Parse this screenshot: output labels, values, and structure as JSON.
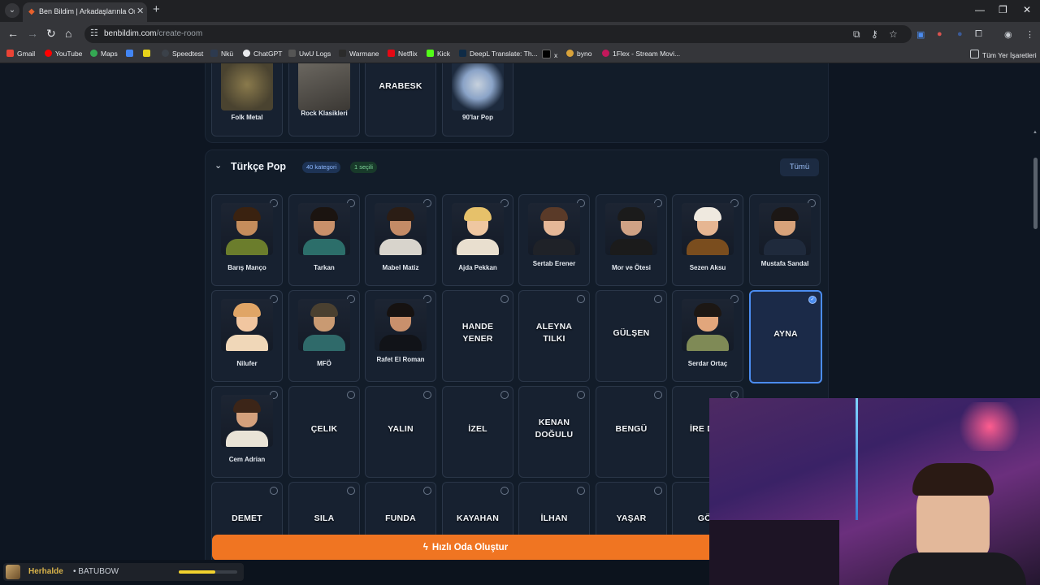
{
  "browser": {
    "tab_title": "Ben Bildim | Arkadaşlarınla Onli...",
    "url_domain": "benbildim.com",
    "url_path": "/create-room",
    "bookmarks": [
      "Gmail",
      "YouTube",
      "Maps",
      "",
      "",
      "Speedtest",
      "Nkü",
      "ChatGPT",
      "UwU Logs",
      "Warmane",
      "Netflix",
      "Kick",
      "DeepL Translate: Th...",
      "x",
      "byno",
      "1Flex - Stream Movi..."
    ],
    "all_bookmarks": "Tüm Yer İşaretleri"
  },
  "colors": {
    "accent": "#4b8cf0",
    "cta": "#f07522",
    "panel": "#121c29"
  },
  "top_section": {
    "cards": [
      {
        "label": "Folk Metal",
        "type": "image"
      },
      {
        "label": "Rock Klasikleri",
        "type": "image"
      },
      {
        "label": "ARABESK",
        "type": "text"
      },
      {
        "label": "90'lar Pop",
        "type": "image"
      }
    ]
  },
  "section": {
    "title": "Türkçe Pop",
    "count_badge": "40 kategori",
    "selected_badge": "1 seçili",
    "all_button": "Tümü",
    "rows": [
      [
        {
          "label": "Barış Manço",
          "type": "avatar",
          "skin": "#c58d5c",
          "hair": "#3a2210",
          "body": "#6b7d2c"
        },
        {
          "label": "Tarkan",
          "type": "avatar",
          "skin": "#c8906a",
          "hair": "#1b1410",
          "body": "#2c6e6a"
        },
        {
          "label": "Mabel Matiz",
          "type": "avatar",
          "skin": "#c48b66",
          "hair": "#2b1d15",
          "body": "#d8d4cc"
        },
        {
          "label": "Ajda Pekkan",
          "type": "avatar",
          "skin": "#efc7a1",
          "hair": "#e6c16a",
          "body": "#e9dfcf"
        },
        {
          "label": "Sertab Erener",
          "type": "avatar",
          "skin": "#e5b797",
          "hair": "#5a3a28",
          "body": "#1f2228"
        },
        {
          "label": "Mor ve Ötesi",
          "type": "avatar",
          "skin": "#cfa285",
          "hair": "#1b1b1b",
          "body": "#1b1b1b"
        },
        {
          "label": "Sezen Aksu",
          "type": "avatar",
          "skin": "#e6b692",
          "hair": "#efe9df",
          "body": "#7a4d1e"
        },
        {
          "label": "Mustafa Sandal",
          "type": "avatar",
          "skin": "#d7a27a",
          "hair": "#1c1715",
          "body": "#1f2a3c"
        }
      ],
      [
        {
          "label": "Nilufer",
          "type": "avatar",
          "skin": "#f1c6a0",
          "hair": "#e0a566",
          "body": "#f0d7b8"
        },
        {
          "label": "MFÖ",
          "type": "avatar",
          "skin": "#c99a72",
          "hair": "#4a4030",
          "body": "#2f6a6a"
        },
        {
          "label": "Rafet El Roman",
          "type": "avatar",
          "skin": "#c9906c",
          "hair": "#161211",
          "body": "#111318"
        },
        {
          "label": "HANDE YENER",
          "type": "text"
        },
        {
          "label": "ALEYNA TILKI",
          "type": "text"
        },
        {
          "label": "GÜLŞEN",
          "type": "text"
        },
        {
          "label": "Serdar Ortaç",
          "type": "avatar",
          "skin": "#e2a67c",
          "hair": "#1c1714",
          "body": "#7f8a56"
        },
        {
          "label": "AYNA",
          "type": "text",
          "selected": true
        }
      ],
      [
        {
          "label": "Cem Adrian",
          "type": "avatar",
          "skin": "#d4a07c",
          "hair": "#3c2518",
          "body": "#e9e3d6"
        },
        {
          "label": "ÇELIK",
          "type": "text"
        },
        {
          "label": "YALIN",
          "type": "text"
        },
        {
          "label": "İZEL",
          "type": "text"
        },
        {
          "label": "KENAN DOĞULU",
          "type": "text"
        },
        {
          "label": "BENGÜ",
          "type": "text"
        },
        {
          "label": "İRE DER",
          "type": "text"
        }
      ],
      [
        {
          "label": "DEMET",
          "type": "text"
        },
        {
          "label": "SILA",
          "type": "text"
        },
        {
          "label": "FUNDA",
          "type": "text"
        },
        {
          "label": "KAYAHAN",
          "type": "text"
        },
        {
          "label": "İLHAN",
          "type": "text"
        },
        {
          "label": "YAŞAR",
          "type": "text"
        },
        {
          "label": "GÖK",
          "type": "text"
        }
      ]
    ]
  },
  "cta_label": "Hızlı Oda Oluştur",
  "player": {
    "song": "Herhalde",
    "separator": "•",
    "artist": "BATUBOW",
    "progress": 0.62
  }
}
